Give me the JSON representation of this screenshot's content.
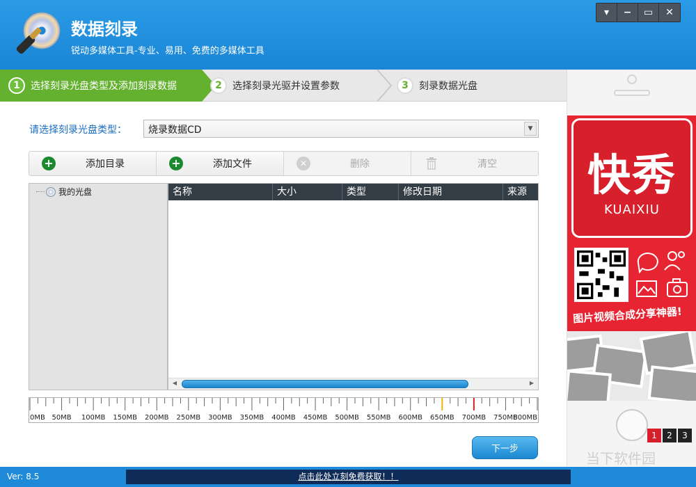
{
  "header": {
    "title": "数据刻录",
    "subtitle": "锐动多媒体工具-专业、易用、免费的多媒体工具",
    "icon": "disc-burn-icon"
  },
  "window_controls": [
    "menu",
    "minimize",
    "maximize",
    "close"
  ],
  "steps": [
    {
      "num": "1",
      "label": "选择刻录光盘类型及添加刻录数据",
      "active": true
    },
    {
      "num": "2",
      "label": "选择刻录光驱并设置参数",
      "active": false
    },
    {
      "num": "3",
      "label": "刻录数据光盘",
      "active": false
    }
  ],
  "disc_type": {
    "label": "请选择刻录光盘类型：",
    "selected": "烧录数据CD"
  },
  "toolbar": {
    "add_dir": "添加目录",
    "add_file": "添加文件",
    "delete": "删除",
    "clear": "清空"
  },
  "tree": {
    "root": "我的光盘"
  },
  "list": {
    "columns": [
      "名称",
      "大小",
      "类型",
      "修改日期",
      "来源"
    ]
  },
  "ruler": {
    "labels": [
      "0MB",
      "50MB",
      "100MB",
      "150MB",
      "200MB",
      "250MB",
      "300MB",
      "350MB",
      "400MB",
      "450MB",
      "500MB",
      "550MB",
      "600MB",
      "650MB",
      "700MB",
      "750MB",
      "800MB"
    ],
    "max_mb": 800,
    "marker_yellow_mb": 650,
    "marker_red_mb": 700
  },
  "next_button": "下一步",
  "ad": {
    "brand": "快秀",
    "brand_sub": "KUAIXIU",
    "slogan": "图片视频合成分享神器!",
    "pages": [
      "1",
      "2",
      "3"
    ],
    "active_page": "1",
    "colors": {
      "brand_red": "#e72532"
    }
  },
  "watermark": "当下软件园",
  "status": {
    "version": "Ver: 8.5",
    "promo": "点击此处立刻免费获取！！"
  },
  "colors": {
    "header_blue": "#1a86d6",
    "step_active_green": "#64b130"
  }
}
